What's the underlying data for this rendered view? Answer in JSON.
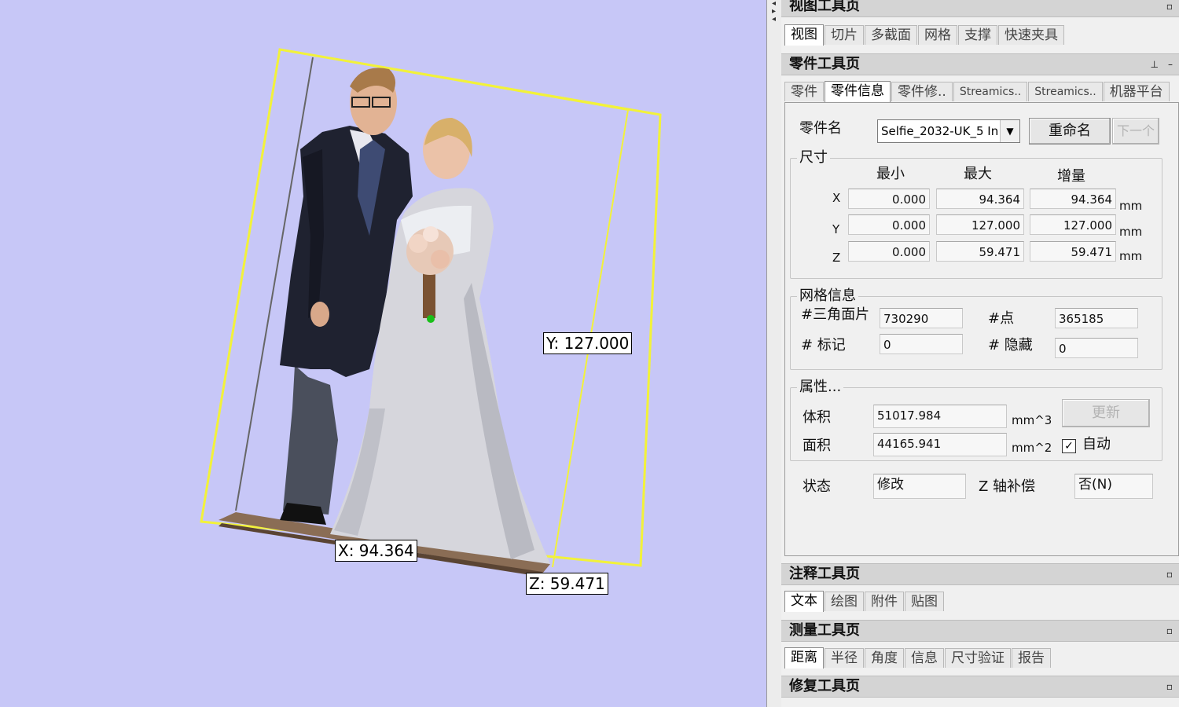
{
  "viewport": {
    "labels": {
      "x": "X: 94.364",
      "y": "Y: 127.000",
      "z": "Z: 59.471"
    }
  },
  "panel": {
    "view_toolbox": {
      "title": "视图工具页",
      "btn": "▫",
      "tabs": [
        "视图",
        "切片",
        "多截面",
        "网格",
        "支撑",
        "快速夹具"
      ]
    },
    "part_toolbox": {
      "title": "零件工具页",
      "pin": "ꟷ",
      "btn": "–",
      "tabs": [
        "零件",
        "零件信息",
        "零件修..",
        "Streamics..",
        "Streamics..",
        "机器平台"
      ],
      "part_name_label": "零件名",
      "part_name_value": "Selfie_2032-UK_5 In",
      "rename_button": "重命名",
      "next_button": "下一个",
      "size": {
        "title": "尺寸",
        "headers": [
          "最小",
          "最大",
          "增量"
        ],
        "rows": [
          {
            "axis": "X",
            "min": "0.000",
            "max": "94.364",
            "delta": "94.364",
            "unit": "mm"
          },
          {
            "axis": "Y",
            "min": "0.000",
            "max": "127.000",
            "delta": "127.000",
            "unit": "mm"
          },
          {
            "axis": "Z",
            "min": "0.000",
            "max": "59.471",
            "delta": "59.471",
            "unit": "mm"
          }
        ]
      },
      "mesh": {
        "title": "网格信息",
        "triangles_label": "#三角面片",
        "triangles_value": "730290",
        "points_label": "#点",
        "points_value": "365185",
        "marks_label": "# 标记",
        "marks_value": "0",
        "hidden_label": "# 隐藏",
        "hidden_value": "0"
      },
      "props": {
        "title": "属性...",
        "volume_label": "体积",
        "volume_value": "51017.984",
        "volume_unit": "mm^3",
        "area_label": "面积",
        "area_value": "44165.941",
        "area_unit": "mm^2",
        "update_button": "更新",
        "auto_label": "自动",
        "auto_checked": true
      },
      "status_label": "状态",
      "status_value": "修改",
      "zcomp_label": "Z 轴补偿",
      "zcomp_value": "否(N)"
    },
    "annot_toolbox": {
      "title": "注释工具页",
      "btn": "▫",
      "tabs": [
        "文本",
        "绘图",
        "附件",
        "贴图"
      ]
    },
    "measure_toolbox": {
      "title": "测量工具页",
      "btn": "▫",
      "tabs": [
        "距离",
        "半径",
        "角度",
        "信息",
        "尺寸验证",
        "报告"
      ]
    },
    "repair_toolbox": {
      "title": "修复工具页",
      "btn": "▫"
    }
  }
}
